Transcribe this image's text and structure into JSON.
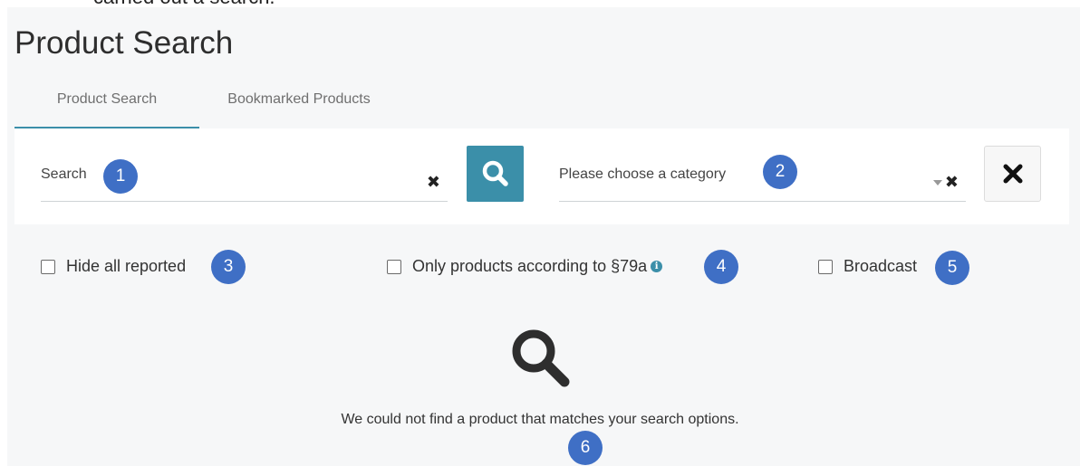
{
  "overlay_text": "carried out a search.",
  "page": {
    "title": "Product Search"
  },
  "tabs": [
    {
      "label": "Product Search",
      "active": true
    },
    {
      "label": "Bookmarked Products",
      "active": false
    }
  ],
  "search": {
    "label": "Search",
    "clear_icon": "close-x-icon",
    "button_icon": "magnifier-icon",
    "badge": "1"
  },
  "category": {
    "placeholder": "Please choose a category",
    "dropdown_icon": "caret-down-icon",
    "clear_icon": "close-x-icon",
    "badge": "2"
  },
  "reset_button": {
    "icon": "close-x-icon"
  },
  "filters": [
    {
      "label": "Hide all reported",
      "checked": false,
      "badge": "3"
    },
    {
      "label": "Only products according to §79a",
      "checked": false,
      "info_icon": "info-circle-icon",
      "badge": "4"
    },
    {
      "label": "Broadcast",
      "checked": false,
      "badge": "5"
    }
  ],
  "empty_state": {
    "icon": "magnifier-icon",
    "message": "We could not find a product that matches your search options.",
    "badge": "6"
  },
  "colors": {
    "accent": "#3b8fa9",
    "badge": "#3f6fc5",
    "panel_bg": "#f6f7f8"
  }
}
